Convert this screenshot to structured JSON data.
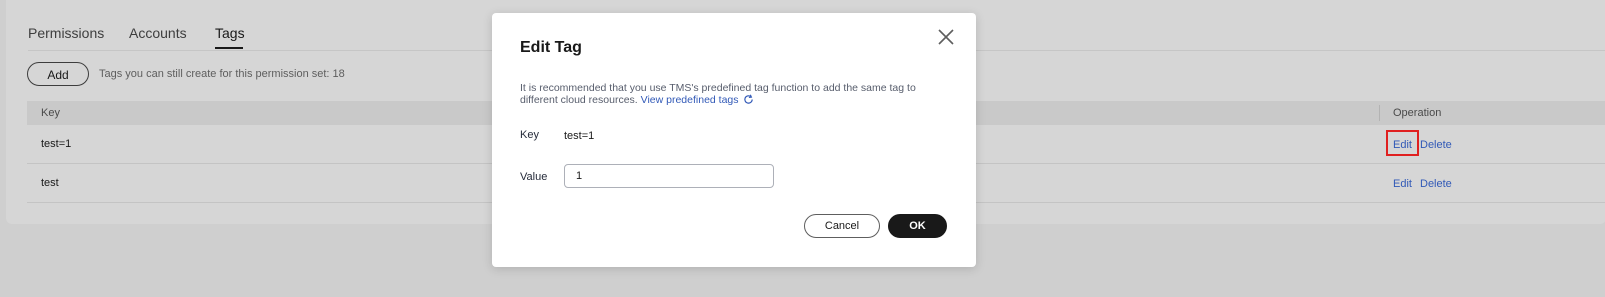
{
  "tabs": [
    {
      "label": "Permissions"
    },
    {
      "label": "Accounts"
    },
    {
      "label": "Tags"
    }
  ],
  "toolbar": {
    "add_label": "Add",
    "hint": "Tags you can still create for this permission set: 18"
  },
  "table": {
    "columns": {
      "key": "Key",
      "operation": "Operation"
    },
    "rows": [
      {
        "key": "test=1",
        "edit": "Edit",
        "delete": "Delete"
      },
      {
        "key": "test",
        "edit": "Edit",
        "delete": "Delete"
      }
    ]
  },
  "dialog": {
    "title": "Edit Tag",
    "notice": "It is recommended that you use TMS's predefined tag function to add the same tag to different cloud resources.",
    "notice_link": "View predefined tags",
    "key_label": "Key",
    "key_value": "test=1",
    "value_label": "Value",
    "value_input": "1",
    "cancel_label": "Cancel",
    "ok_label": "OK"
  },
  "colors": {
    "link": "#3159b7",
    "primary_button": "#191919",
    "highlight_box": "#e02020"
  },
  "icons": [
    "close-icon",
    "refresh-icon"
  ]
}
